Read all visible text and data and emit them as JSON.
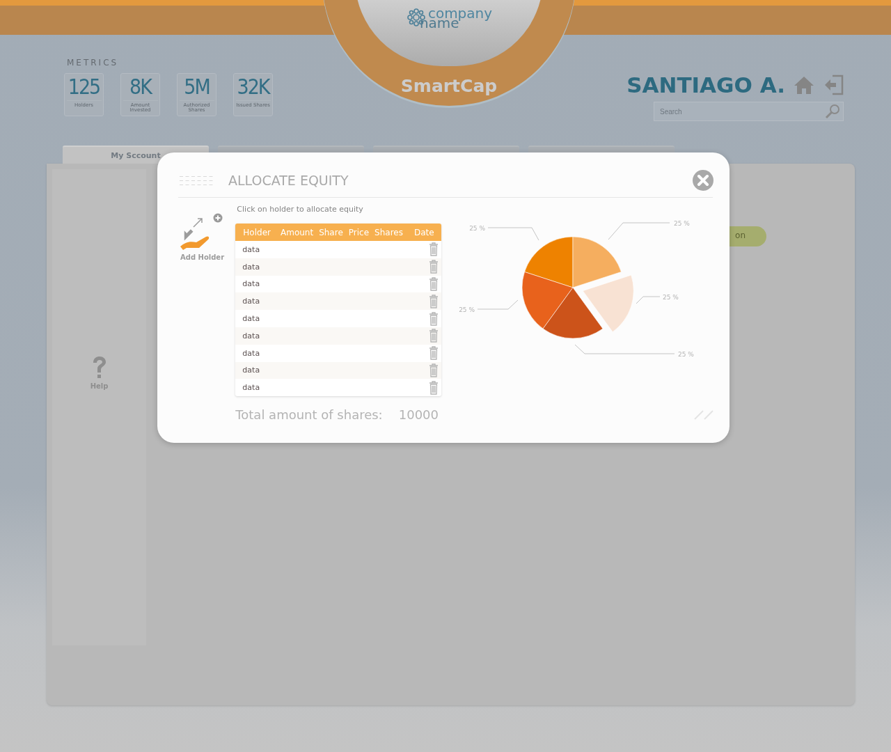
{
  "header": {
    "brand": {
      "company_line1": "company",
      "company_line2": "name",
      "product": "SmartCap"
    },
    "metrics": {
      "title": "METRICS",
      "items": [
        {
          "value": "125",
          "label": "Holders"
        },
        {
          "value": "8K",
          "label": "Amount Invested"
        },
        {
          "value": "5M",
          "label": "Authorized Shares"
        },
        {
          "value": "32K",
          "label": "Issued Shares"
        }
      ]
    },
    "user": {
      "name": "SANTIAGO A.",
      "search": {
        "placeholder": "Search"
      }
    }
  },
  "tabs": [
    {
      "label": "My Sccount",
      "selected": true
    },
    {
      "selected": false
    },
    {
      "selected": false
    },
    {
      "selected": false
    }
  ],
  "sidebar": {
    "help_label": "Help"
  },
  "content": {
    "button_label": "on"
  },
  "modal": {
    "title": "ALLOCATE EQUITY",
    "add_holder_label": "Add Holder",
    "hint": "Click on holder to allocate equity",
    "table": {
      "columns": [
        "Holder",
        "Amount",
        "Share",
        "Price",
        "Shares",
        "Date"
      ],
      "rows": [
        {
          "holder": "data"
        },
        {
          "holder": "data"
        },
        {
          "holder": "data"
        },
        {
          "holder": "data"
        },
        {
          "holder": "data"
        },
        {
          "holder": "data"
        },
        {
          "holder": "data"
        },
        {
          "holder": "data"
        },
        {
          "holder": "data"
        }
      ]
    },
    "total_label": "Total amount of shares:",
    "total_value": "10000",
    "chart_data": {
      "type": "pie",
      "values": [
        25,
        25,
        25,
        25,
        25
      ],
      "colors": [
        "#ee8200",
        "#e8621c",
        "#cc531a",
        "#f8e2d3",
        "#f5ae5f"
      ],
      "data_labels": true,
      "value_labels": [
        "25 %",
        "25 %",
        "25 %",
        "25 %",
        "25 %"
      ]
    },
    "pie_slices": [
      {
        "exploded": false
      },
      {
        "exploded": false
      },
      {
        "exploded": false
      },
      {
        "exploded": true
      },
      {
        "exploded": false
      }
    ]
  }
}
